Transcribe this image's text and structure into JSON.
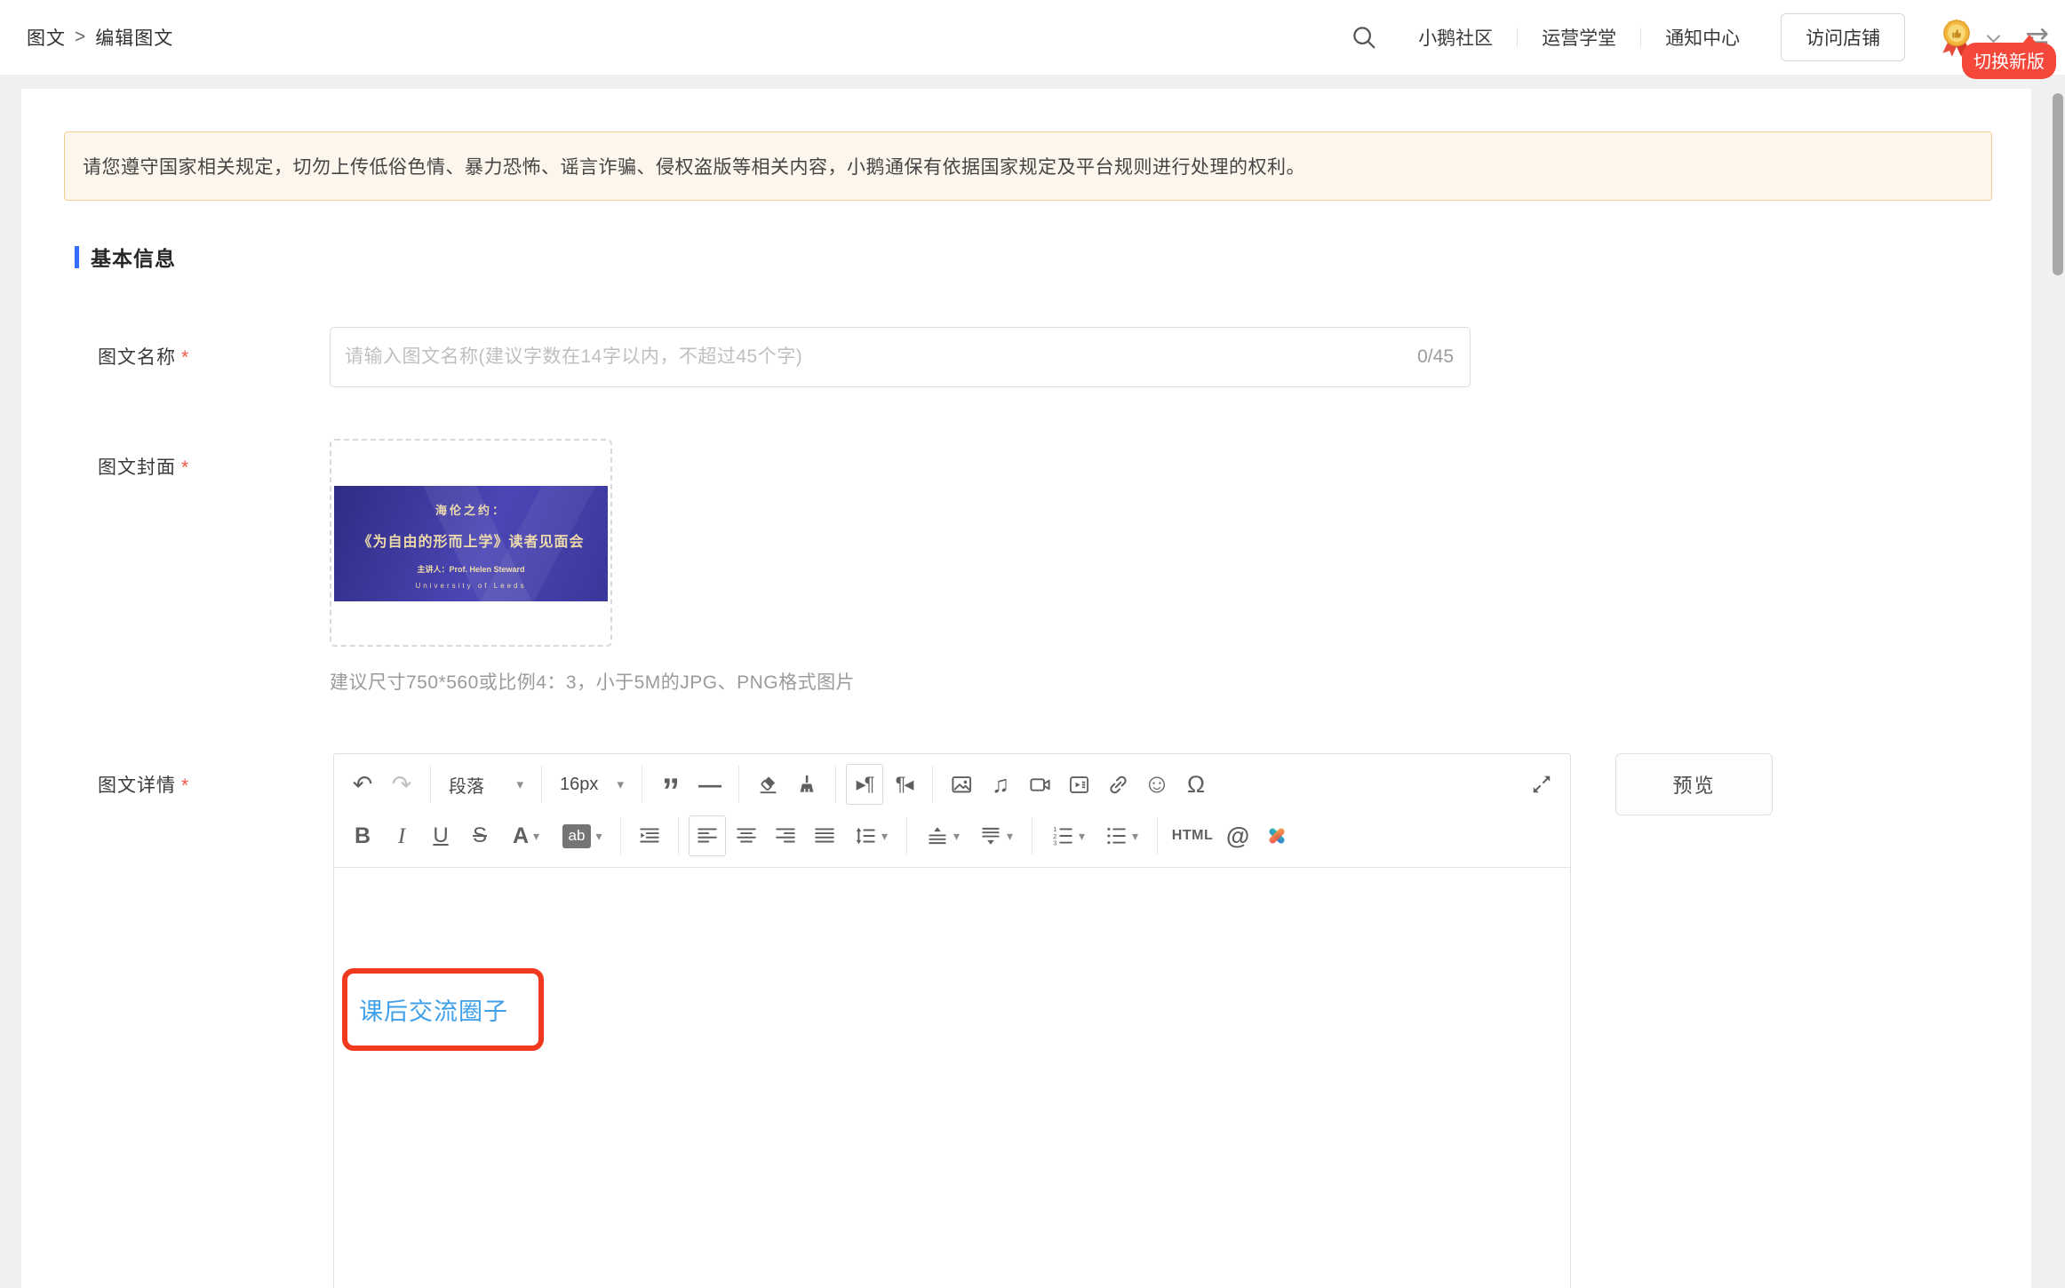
{
  "header": {
    "breadcrumb": {
      "parent": "图文",
      "separator": ">",
      "current": "编辑图文"
    },
    "nav_items": [
      "小鹅社区",
      "运营学堂",
      "通知中心"
    ],
    "visit_store": "访问店铺",
    "switch_version_badge": "切换新版"
  },
  "notice": "请您遵守国家相关规定，切勿上传低俗色情、暴力恐怖、谣言诈骗、侵权盗版等相关内容，小鹅通保有依据国家规定及平台规则进行处理的权利。",
  "section_title": "基本信息",
  "form": {
    "name": {
      "label": "图文名称",
      "required_mark": "*",
      "placeholder": "请输入图文名称(建议字数在14字以内，不超过45个字)",
      "value": "",
      "counter": "0/45"
    },
    "cover": {
      "label": "图文封面",
      "required_mark": "*",
      "hint": "建议尺寸750*560或比例4：3，小于5M的JPG、PNG格式图片",
      "poster": {
        "title": "海伦之约：",
        "subtitle": "《为自由的形而上学》读者见面会",
        "speaker": "主讲人：Prof. Helen Steward",
        "affiliation": "University of Leeds"
      }
    },
    "detail": {
      "label": "图文详情",
      "required_mark": "*",
      "preview_button": "预览",
      "content_link_text": "课后交流圈子"
    }
  },
  "editor": {
    "paragraph_select": "段落",
    "font_size_select": "16px",
    "html_button": "HTML"
  },
  "icons": {
    "undo": "↶",
    "redo": "↷",
    "caret_down": "▾",
    "blockquote": "”",
    "horizontal_rule": "—",
    "indent_first_line": "▸¶",
    "remove_indent": "¶◂",
    "music_note": "♫",
    "smiley": "☺",
    "omega": "Ω",
    "bold": "B",
    "italic": "I",
    "underline": "U",
    "strikethrough": "S",
    "font_color": "A",
    "bg_color": "ab",
    "at_search": "@",
    "swap": "⇄"
  },
  "colors": {
    "accent_blue": "#3370ff",
    "link_blue": "#3ea0ea",
    "annotation_red": "#f0391f",
    "badge_red": "#f5483b",
    "notice_bg": "#fdf6ec",
    "notice_border": "#f3cf96",
    "required_red": "#f25643"
  }
}
